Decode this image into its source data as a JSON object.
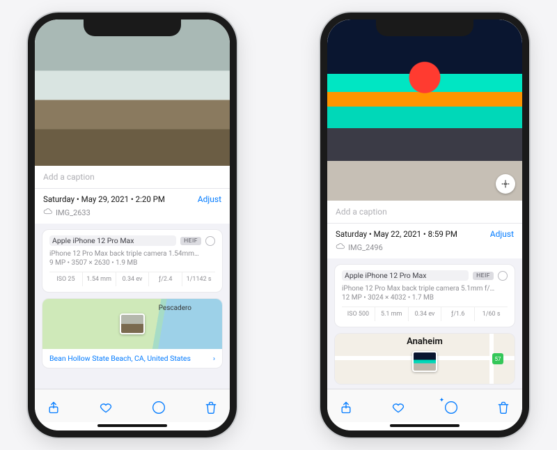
{
  "phones": [
    {
      "caption_placeholder": "Add a caption",
      "date_line": "Saturday  •  May 29, 2021  •  2:20 PM",
      "adjust_label": "Adjust",
      "filename": "IMG_2633",
      "device": "Apple iPhone 12 Pro Max",
      "format_badge": "HEIF",
      "camera_line": "iPhone 12 Pro Max back triple camera 1.54mm…",
      "resolution_line": "9 MP  •  3507 × 2630  •  1.9 MB",
      "stats": {
        "iso": "ISO 25",
        "focal": "1.54 mm",
        "ev": "0.34 ev",
        "aperture": "ƒ/2.4",
        "shutter": "1/1142 s"
      },
      "map_label": "Pescadero",
      "location_line": "Bean Hollow State Beach, CA, United States"
    },
    {
      "caption_placeholder": "Add a caption",
      "date_line": "Saturday  •  May 22, 2021  •  8:59 PM",
      "adjust_label": "Adjust",
      "filename": "IMG_2496",
      "device": "Apple iPhone 12 Pro Max",
      "format_badge": "HEIF",
      "camera_line": "iPhone 12 Pro Max back triple camera 5.1mm f/…",
      "resolution_line": "12 MP  •  3024 × 4032  •  1.7 MB",
      "stats": {
        "iso": "ISO 500",
        "focal": "5.1 mm",
        "ev": "0.34 ev",
        "aperture": "ƒ/1.6",
        "shutter": "1/60 s"
      },
      "map_label": "Anaheim",
      "highway_badge": "57"
    }
  ]
}
